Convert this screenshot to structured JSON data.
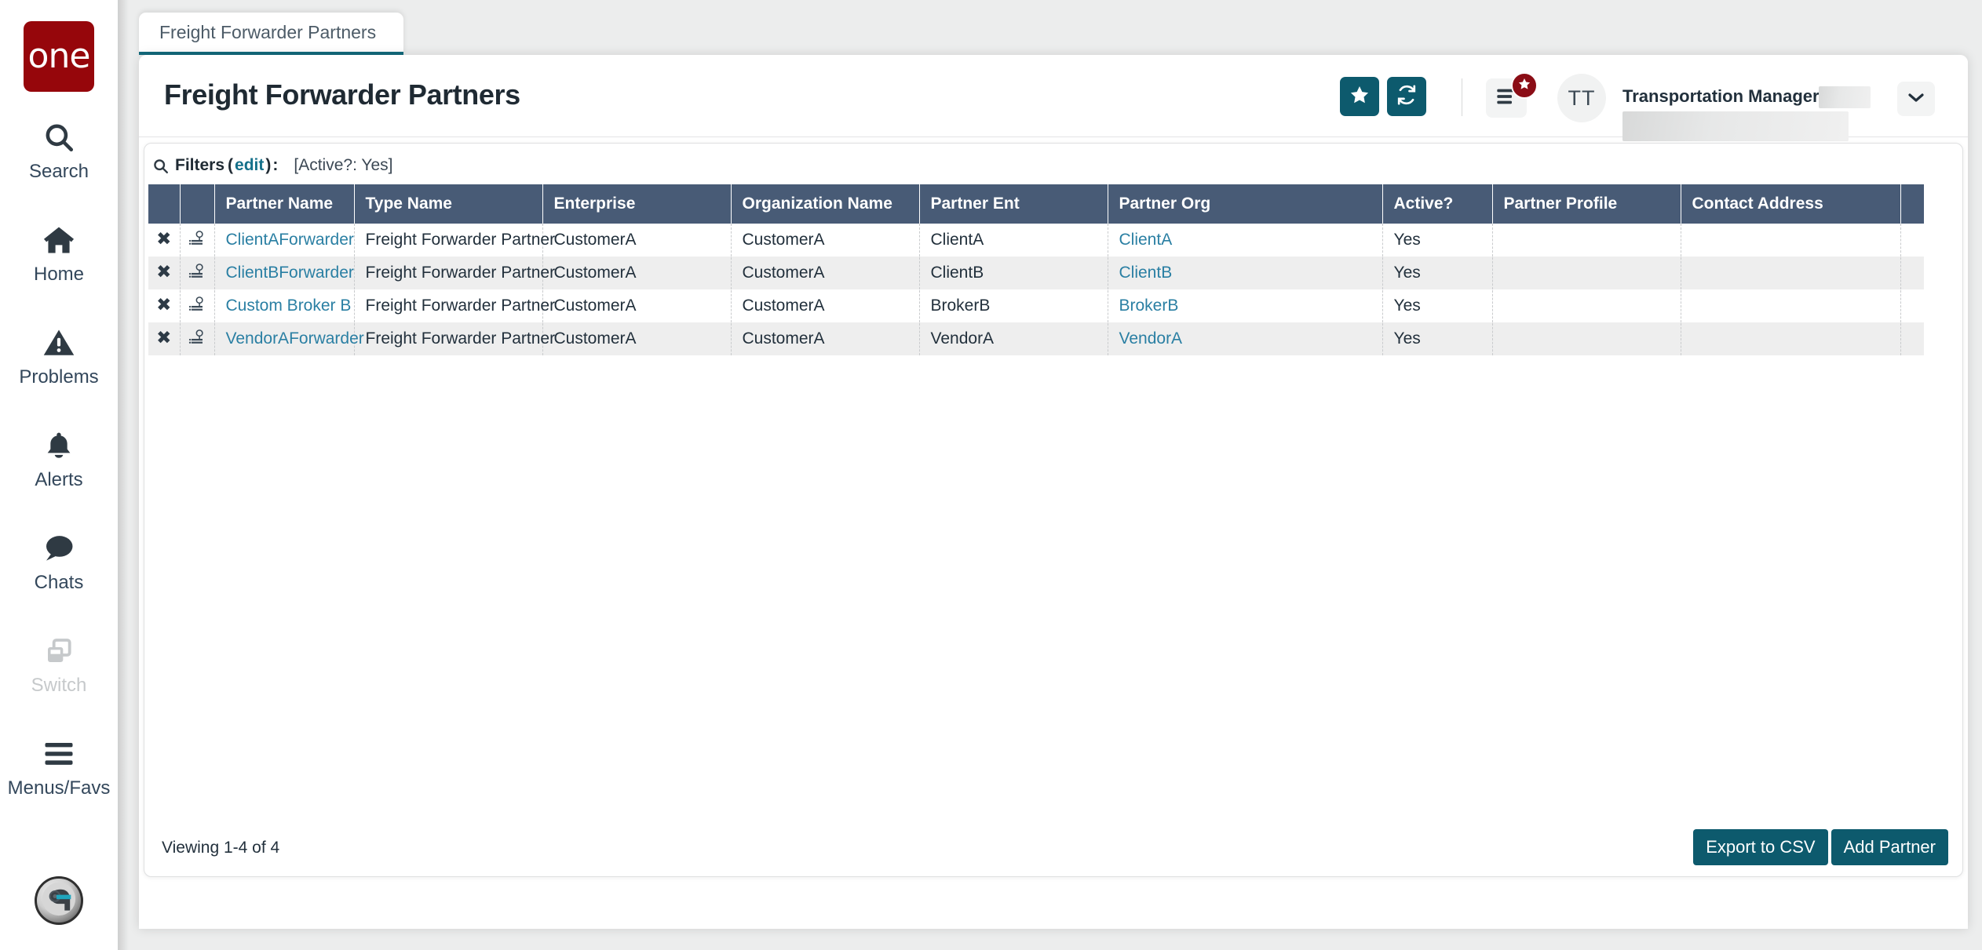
{
  "brand": {
    "logo_text": "one"
  },
  "sidebar": {
    "items": [
      {
        "label": "Search",
        "icon": "search-icon",
        "disabled": false
      },
      {
        "label": "Home",
        "icon": "home-icon",
        "disabled": false
      },
      {
        "label": "Problems",
        "icon": "warning-icon",
        "disabled": false
      },
      {
        "label": "Alerts",
        "icon": "bell-icon",
        "disabled": false
      },
      {
        "label": "Chats",
        "icon": "chat-icon",
        "disabled": false
      },
      {
        "label": "Switch",
        "icon": "switch-icon",
        "disabled": true
      },
      {
        "label": "Menus/Favs",
        "icon": "hamburger-icon",
        "disabled": false
      }
    ],
    "assistant_avatar": "robot-avatar-icon"
  },
  "tab": {
    "label": "Freight Forwarder Partners"
  },
  "header": {
    "title": "Freight Forwarder Partners",
    "favorite_icon": "star-icon",
    "refresh_icon": "refresh-icon",
    "menu_icon": "hamburger-icon",
    "menu_badge_icon": "star-badge-icon",
    "avatar_initials": "TT",
    "user_role": "Transportation Manager",
    "caret_icon": "chevron-down-icon"
  },
  "filters": {
    "icon": "search-icon",
    "label": "Filters",
    "edit_label": "edit",
    "open_paren": "(",
    "close_paren": ")",
    "colon": ":",
    "value": "[Active?: Yes]"
  },
  "table": {
    "columns": [
      "",
      "",
      "Partner Name",
      "Type Name",
      "Enterprise",
      "Organization Name",
      "Partner Ent",
      "Partner Org",
      "Active?",
      "Partner Profile",
      "Contact Address",
      ""
    ],
    "delete_icon": "delete-x-icon",
    "row_icon": "hierarchy-icon",
    "rows": [
      {
        "partner_name": "ClientAForwarder",
        "type_name": "Freight Forwarder Partner",
        "enterprise": "CustomerA",
        "organization_name": "CustomerA",
        "partner_ent": "ClientA",
        "partner_org": "ClientA",
        "active": "Yes",
        "partner_profile": "",
        "contact_address": ""
      },
      {
        "partner_name": "ClientBForwarder",
        "type_name": "Freight Forwarder Partner",
        "enterprise": "CustomerA",
        "organization_name": "CustomerA",
        "partner_ent": "ClientB",
        "partner_org": "ClientB",
        "active": "Yes",
        "partner_profile": "",
        "contact_address": ""
      },
      {
        "partner_name": "Custom Broker B",
        "type_name": "Freight Forwarder Partner",
        "enterprise": "CustomerA",
        "organization_name": "CustomerA",
        "partner_ent": "BrokerB",
        "partner_org": "BrokerB",
        "active": "Yes",
        "partner_profile": "",
        "contact_address": ""
      },
      {
        "partner_name": "VendorAForwarder",
        "type_name": "Freight Forwarder Partner",
        "enterprise": "CustomerA",
        "organization_name": "CustomerA",
        "partner_ent": "VendorA",
        "partner_org": "VendorA",
        "active": "Yes",
        "partner_profile": "",
        "contact_address": ""
      }
    ]
  },
  "footer": {
    "viewing": "Viewing 1-4 of 4",
    "export_label": "Export to CSV",
    "add_label": "Add Partner"
  },
  "colors": {
    "brand_red": "#96060b",
    "accent_teal": "#0d5a6e",
    "tab_underline": "#136a7c",
    "table_header": "#485b76",
    "link": "#2a7fa3",
    "badge_red": "#8b0d16"
  }
}
